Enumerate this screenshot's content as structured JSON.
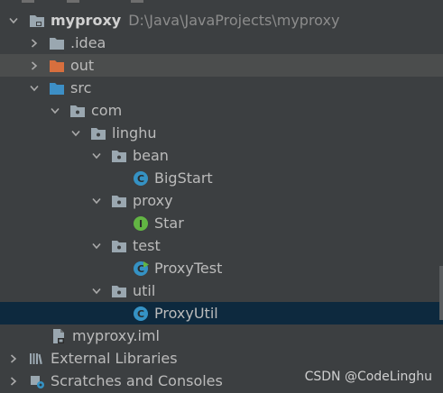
{
  "project": {
    "name": "myproxy",
    "path": "D:\\Java\\JavaProjects\\myproxy"
  },
  "tree": [
    {
      "id": "idea",
      "label": ".idea",
      "icon": "folder-gray-icon",
      "expander": "collapsed"
    },
    {
      "id": "out",
      "label": "out",
      "icon": "folder-orange-icon",
      "expander": "collapsed"
    },
    {
      "id": "src",
      "label": "src",
      "icon": "folder-blue-icon",
      "expander": "expanded"
    },
    {
      "id": "com",
      "label": "com",
      "icon": "package-icon",
      "expander": "expanded"
    },
    {
      "id": "linghu",
      "label": "linghu",
      "icon": "package-icon",
      "expander": "expanded"
    },
    {
      "id": "bean",
      "label": "bean",
      "icon": "package-icon",
      "expander": "expanded"
    },
    {
      "id": "bigstart",
      "label": "BigStart",
      "icon": "class-icon",
      "expander": "none"
    },
    {
      "id": "proxy",
      "label": "proxy",
      "icon": "package-icon",
      "expander": "expanded"
    },
    {
      "id": "star",
      "label": "Star",
      "icon": "interface-icon",
      "expander": "none"
    },
    {
      "id": "test",
      "label": "test",
      "icon": "package-icon",
      "expander": "expanded"
    },
    {
      "id": "proxytest",
      "label": "ProxyTest",
      "icon": "test-class-icon",
      "expander": "none"
    },
    {
      "id": "util",
      "label": "util",
      "icon": "package-icon",
      "expander": "expanded"
    },
    {
      "id": "proxyutil",
      "label": "ProxyUtil",
      "icon": "class-icon",
      "expander": "none"
    },
    {
      "id": "iml",
      "label": "myproxy.iml",
      "icon": "module-file-icon",
      "expander": "none"
    },
    {
      "id": "extlibs",
      "label": "External Libraries",
      "icon": "libraries-icon",
      "expander": "collapsed"
    },
    {
      "id": "scratches",
      "label": "Scratches and Consoles",
      "icon": "scratches-icon",
      "expander": "collapsed"
    }
  ],
  "colors": {
    "background": "#3c3f41",
    "selected_row": "#0d293e",
    "highlighted_row": "#4b4d4d",
    "class_icon": "#3592c4",
    "interface_icon": "#62b543",
    "orange_folder": "#d76f3e",
    "blue_folder": "#3d8fc6"
  },
  "watermark": "CSDN @CodeLinghu"
}
